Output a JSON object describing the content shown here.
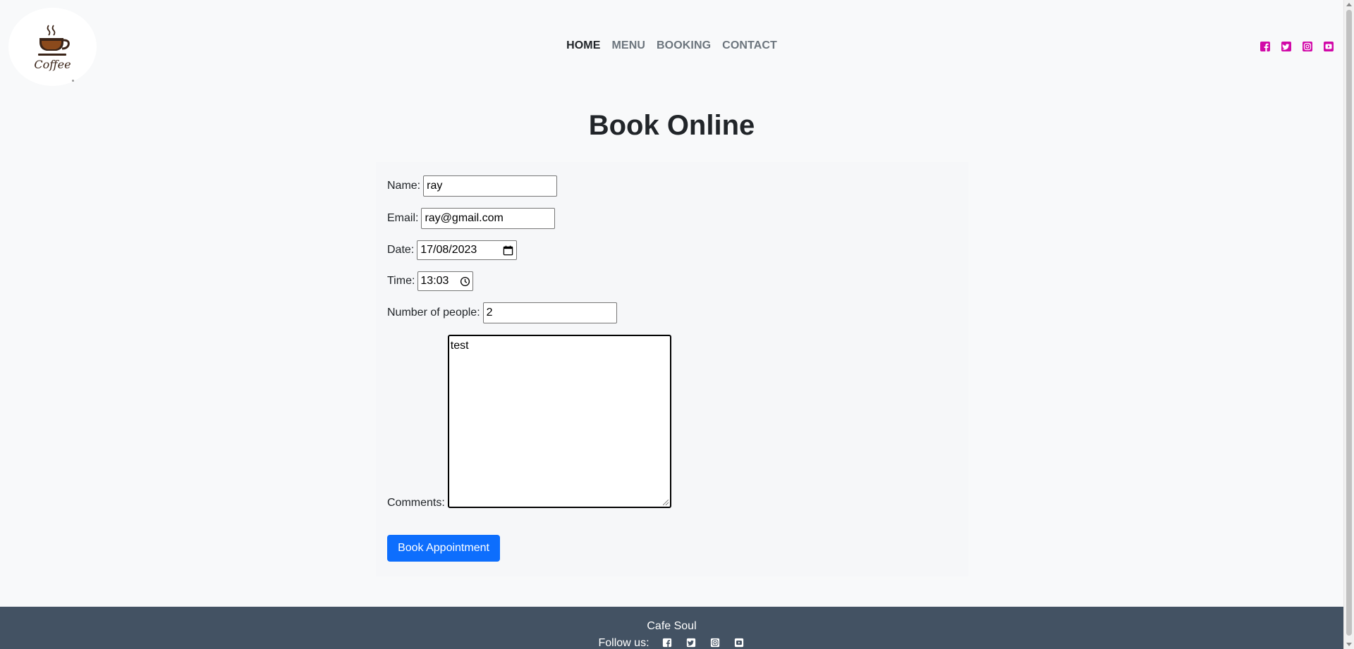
{
  "header": {
    "logo_text": "Coffee",
    "nav": [
      {
        "label": "HOME",
        "active": true
      },
      {
        "label": "MENU",
        "active": false
      },
      {
        "label": "BOOKING",
        "active": false
      },
      {
        "label": "CONTACT",
        "active": false
      }
    ],
    "social_icons": [
      "facebook-icon",
      "twitter-icon",
      "instagram-icon",
      "youtube-icon"
    ],
    "social_color": "#d10aa8"
  },
  "main": {
    "title": "Book Online",
    "form": {
      "name_label": "Name:",
      "name_value": "ray",
      "email_label": "Email:",
      "email_value": "ray@gmail.com",
      "date_label": "Date:",
      "date_value": "17/08/2023",
      "time_label": "Time:",
      "time_value": "13:03",
      "people_label": "Number of people:",
      "people_value": "2",
      "comments_label": "Comments:",
      "comments_value": "test",
      "submit_label": "Book Appointment"
    },
    "accent_color": "#0d6efd"
  },
  "footer": {
    "brand": "Cafe Soul",
    "follow_label": "Follow us:",
    "background": "#435263"
  }
}
